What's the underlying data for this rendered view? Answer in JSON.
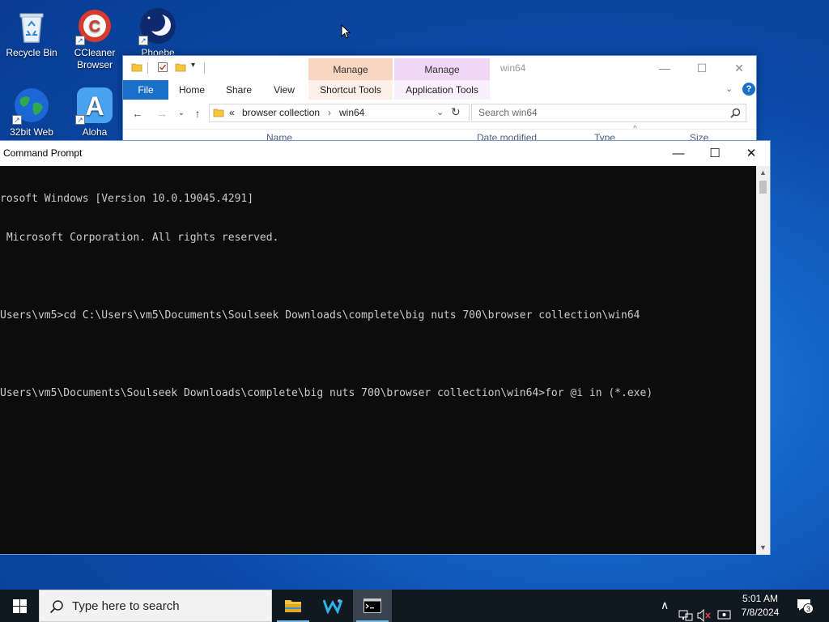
{
  "desktop": {
    "icons": [
      {
        "label": "Recycle Bin",
        "icon": "recycle-bin-icon"
      },
      {
        "label": "CCleaner Browser",
        "icon": "ccleaner-icon"
      },
      {
        "label": "Phoebe",
        "icon": "moon-icon"
      },
      {
        "label": "32bit Web",
        "icon": "globe-icon"
      },
      {
        "label": "Aloha",
        "icon": "aloha-icon"
      }
    ]
  },
  "explorer": {
    "title": "win64",
    "context_tabs": [
      {
        "group": "Manage",
        "label": "Shortcut Tools",
        "color": "#f9d6c1"
      },
      {
        "group": "Manage",
        "label": "Application Tools",
        "color": "#f0d7f5"
      }
    ],
    "ribbon_tabs": [
      "File",
      "Home",
      "Share",
      "View"
    ],
    "breadcrumb_prefix": "«",
    "breadcrumb": [
      "browser collection",
      "win64"
    ],
    "search_placeholder": "Search win64",
    "columns": [
      "Name",
      "Date modified",
      "Type",
      "Size"
    ]
  },
  "cmd": {
    "title": "Command Prompt",
    "lines": [
      "rosoft Windows [Version 10.0.19045.4291]",
      " Microsoft Corporation. All rights reserved.",
      "",
      "Users\\vm5>cd C:\\Users\\vm5\\Documents\\Soulseek Downloads\\complete\\big nuts 700\\browser collection\\win64",
      "",
      "Users\\vm5\\Documents\\Soulseek Downloads\\complete\\big nuts 700\\browser collection\\win64>for @i in (*.exe)"
    ]
  },
  "taskbar": {
    "search_placeholder": "Type here to search",
    "apps": [
      {
        "name": "file-explorer",
        "active": false
      },
      {
        "name": "wavebox",
        "active": false
      },
      {
        "name": "command-prompt",
        "active": true
      }
    ],
    "time": "5:01 AM",
    "date": "7/8/2024",
    "notification_count": "3"
  },
  "colors": {
    "accent": "#0078d7",
    "file_tab": "#1a6fc9"
  }
}
